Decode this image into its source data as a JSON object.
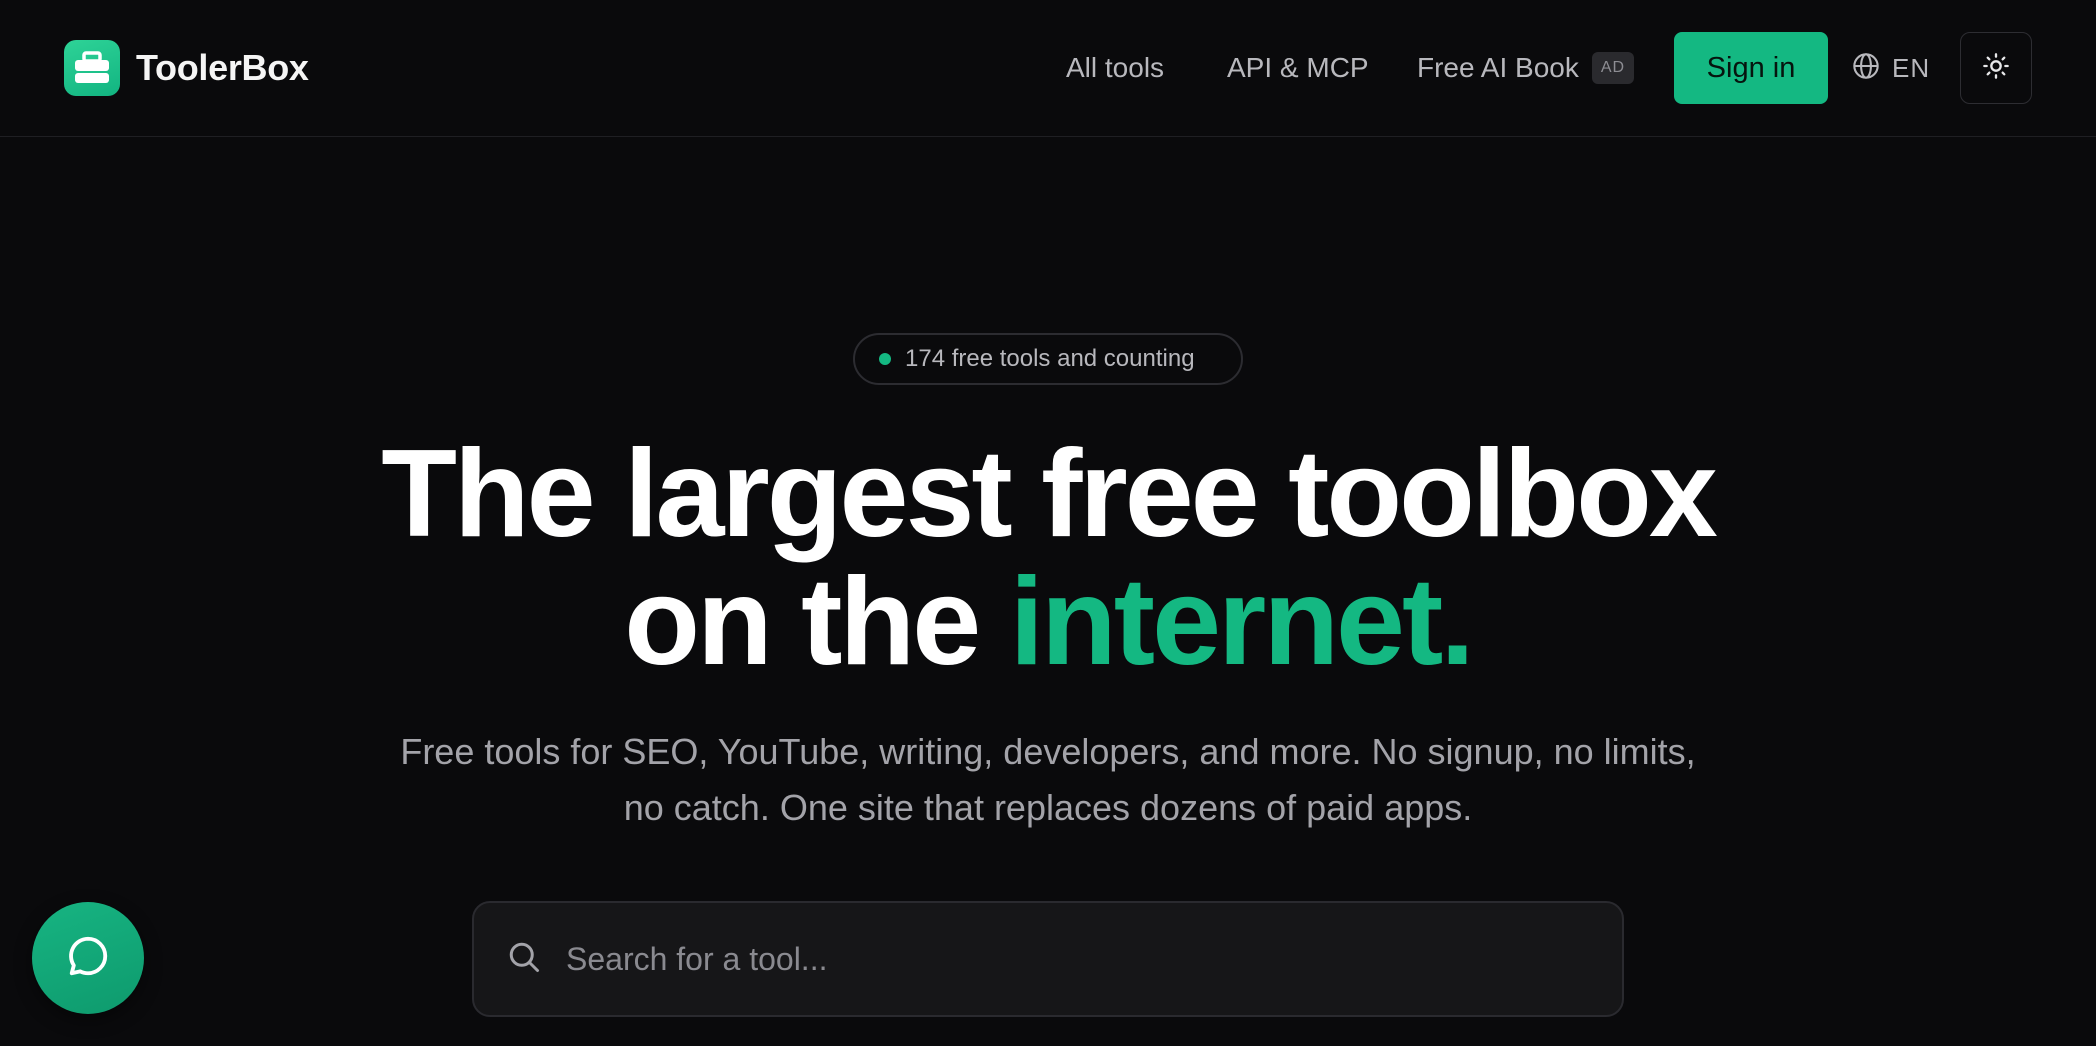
{
  "header": {
    "brand_name": "ToolerBox",
    "nav": {
      "all_tools": "All tools",
      "api_mcp": "API & MCP",
      "free_ai_book": "Free AI Book",
      "ad_badge": "AD"
    },
    "sign_in_label": "Sign in",
    "language_label": "EN",
    "icons": {
      "logo": "toolbox-icon",
      "language": "globe-icon",
      "theme": "sun-icon"
    }
  },
  "hero": {
    "badge_text": "174 free tools and counting",
    "headline_line1": "The largest free toolbox",
    "headline_line2_prefix": "on the ",
    "headline_line2_accent": "internet.",
    "subtitle": "Free tools for SEO, YouTube, writing, developers, and more. No signup, no limits, no catch. One site that replaces dozens of paid apps.",
    "search": {
      "placeholder": "Search for a tool...",
      "value": "",
      "icon": "search-icon"
    }
  },
  "chat_widget": {
    "icon": "chat-bubble-icon"
  },
  "colors": {
    "background": "#0a0a0c",
    "accent": "#14b882",
    "text_primary": "#ffffff",
    "text_muted": "#a3a3a9"
  }
}
